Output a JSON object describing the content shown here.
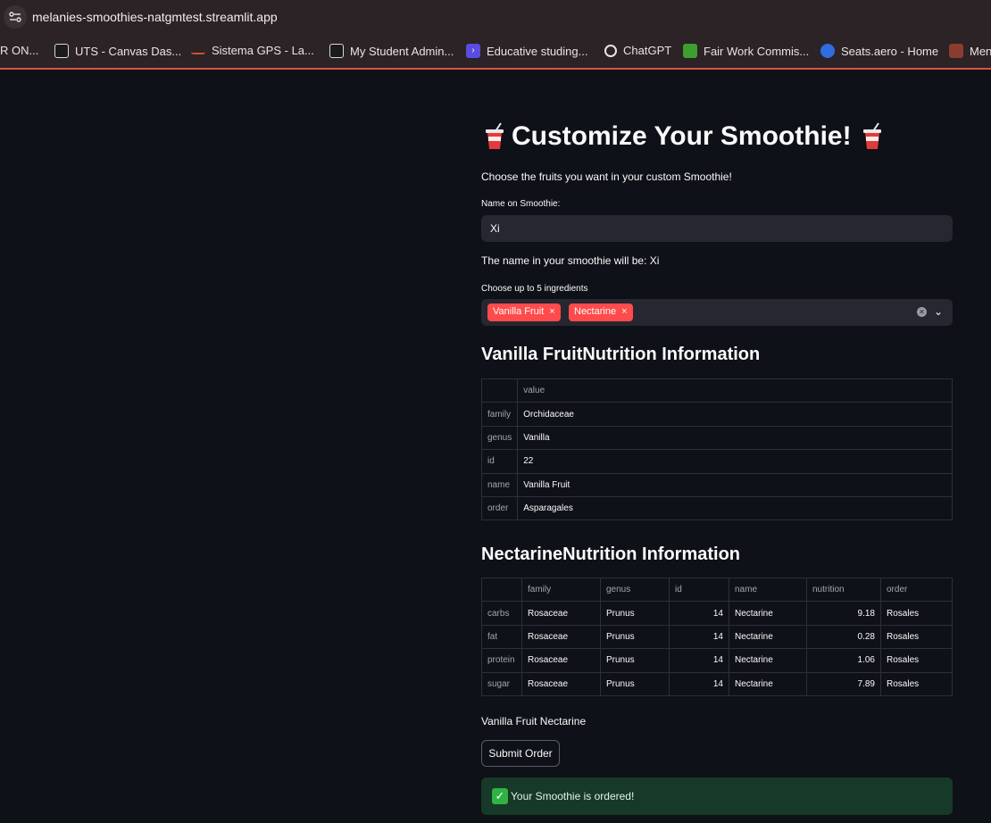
{
  "browser": {
    "url": "melanies-smoothies-natgmtest.streamlit.app",
    "bookmarks": [
      {
        "label": "R ON...",
        "icon": "none"
      },
      {
        "label": "UTS - Canvas Das...",
        "icon": "uts-icon"
      },
      {
        "label": "Sistema GPS -  La...",
        "icon": "gps-icon"
      },
      {
        "label": "My Student Admin...",
        "icon": "uts-icon"
      },
      {
        "label": "Educative studing...",
        "icon": "educative-icon"
      },
      {
        "label": "ChatGPT",
        "icon": "chatgpt-icon"
      },
      {
        "label": "Fair Work Commis...",
        "icon": "fairwork-icon"
      },
      {
        "label": "Seats.aero - Home",
        "icon": "seats-icon"
      },
      {
        "label": "Men",
        "icon": "men-icon"
      }
    ]
  },
  "app": {
    "title": "Customize Your Smoothie!",
    "subtitle": "Choose the fruits you want in your custom Smoothie!",
    "name_label": "Name on Smoothie:",
    "name_value": "Xi",
    "name_confirm": "The name in your smoothie will be: Xi",
    "ingredients_label": "Choose up to 5 ingredients",
    "selected": [
      "Vanilla Fruit",
      "Nectarine"
    ],
    "tag_remove": "×",
    "table1": {
      "heading": "Vanilla FruitNutrition Information",
      "column": "value",
      "rows": [
        {
          "index": "family",
          "value": "Orchidaceae"
        },
        {
          "index": "genus",
          "value": "Vanilla"
        },
        {
          "index": "id",
          "value": "22"
        },
        {
          "index": "name",
          "value": "Vanilla Fruit"
        },
        {
          "index": "order",
          "value": "Asparagales"
        }
      ]
    },
    "table2": {
      "heading": "NectarineNutrition Information",
      "columns": [
        "family",
        "genus",
        "id",
        "name",
        "nutrition",
        "order"
      ],
      "rows": [
        {
          "index": "carbs",
          "family": "Rosaceae",
          "genus": "Prunus",
          "id": "14",
          "name": "Nectarine",
          "nutrition": "9.18",
          "order": "Rosales"
        },
        {
          "index": "fat",
          "family": "Rosaceae",
          "genus": "Prunus",
          "id": "14",
          "name": "Nectarine",
          "nutrition": "0.28",
          "order": "Rosales"
        },
        {
          "index": "protein",
          "family": "Rosaceae",
          "genus": "Prunus",
          "id": "14",
          "name": "Nectarine",
          "nutrition": "1.06",
          "order": "Rosales"
        },
        {
          "index": "sugar",
          "family": "Rosaceae",
          "genus": "Prunus",
          "id": "14",
          "name": "Nectarine",
          "nutrition": "7.89",
          "order": "Rosales"
        }
      ]
    },
    "ingredients_string": "Vanilla Fruit Nectarine",
    "submit_label": "Submit Order",
    "success_message": "Your Smoothie is ordered!",
    "colors": {
      "accent": "#ff4b4b",
      "background": "#0e1117",
      "input": "#262730",
      "success_bg": "#173928"
    }
  }
}
